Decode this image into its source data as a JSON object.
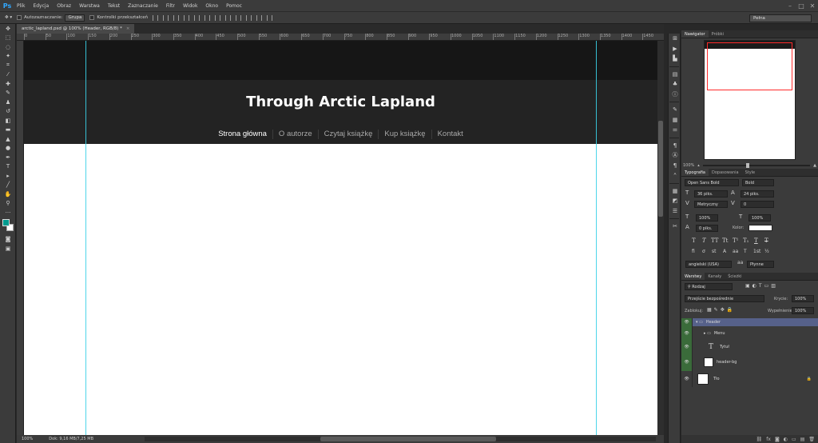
{
  "app": {
    "logo": "Ps",
    "menu": [
      "Plik",
      "Edycja",
      "Obraz",
      "Warstwa",
      "Tekst",
      "Zaznaczanie",
      "Filtr",
      "Widok",
      "Okno",
      "Pomoc"
    ]
  },
  "options_bar": {
    "auto_select_label": "Autozaznaczanie:",
    "auto_select_value": "Grupa",
    "transform_label": "Kontrolki przekształceń",
    "workspace": "Pełna"
  },
  "document": {
    "tab_title": "arctic_lapland.psd @ 100% (Header, RGB/8) *",
    "ruler_labels": [
      "0",
      "50",
      "100",
      "150",
      "200",
      "250",
      "300",
      "350",
      "400",
      "450",
      "500",
      "550",
      "600",
      "650",
      "700",
      "750",
      "800",
      "850",
      "900",
      "950",
      "1000",
      "1050",
      "1100",
      "1150",
      "1200",
      "1250",
      "1300",
      "1350",
      "1400",
      "1450"
    ],
    "status_zoom": "100%",
    "status_doc": "Dok: 9,16 MB/7,25 MB"
  },
  "site": {
    "title": "Through Arctic Lapland",
    "menu": [
      "Strona główna",
      "O autorze",
      "Czytaj książkę",
      "Kup książkę",
      "Kontakt"
    ]
  },
  "panels": {
    "navigator_tabs": [
      "Nawigator",
      "Próbki"
    ],
    "nav_zoom": "100%",
    "typo_tabs": [
      "Typografia",
      "Dopasowania",
      "Style"
    ],
    "font_family": "Open Sans Bold",
    "font_style": "Bold",
    "font_size": "36 piks.",
    "leading": "24 piks.",
    "kerning": "Metryczny",
    "tracking": "0",
    "vscale": "100%",
    "hscale": "100%",
    "baseline": "0 piks.",
    "color_label": "Kolor:",
    "text_buttons": [
      "T",
      "T",
      "TT",
      "Tt",
      "T¹",
      "T₁",
      "T",
      "T"
    ],
    "opentype_buttons": [
      "fi",
      "ơ",
      "st",
      "A",
      "aa",
      "T",
      "1st",
      "½"
    ],
    "language": "angielski (USA)",
    "antialias": "Płynne",
    "layers_tabs": [
      "Warstwy",
      "Kanały",
      "Ścieżki"
    ],
    "filter_kind": "Rodzaj",
    "blend_mode": "Przejście bezpośrednie",
    "opacity_label": "Krycie:",
    "opacity": "100%",
    "lock_label": "Zablokuj:",
    "fill_label": "Wypełnienie:",
    "fill": "100%",
    "layers": [
      "Header",
      "Menu",
      "Tytuł",
      "header-bg",
      "Tło"
    ]
  },
  "colors": {
    "foreground": "#009b8f",
    "background": "#ffffff",
    "guide": "#3ad1e8"
  }
}
